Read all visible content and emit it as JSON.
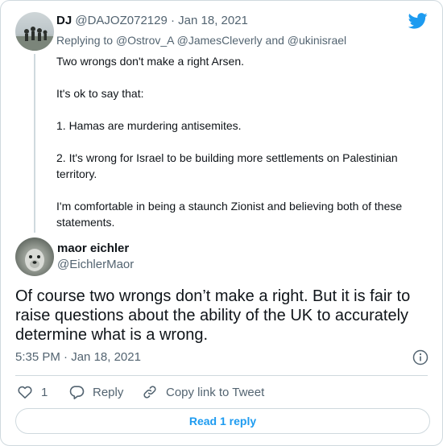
{
  "colors": {
    "accent": "#1d9bf0",
    "secondary_text": "#536471",
    "border": "#cfd9de"
  },
  "parent": {
    "name": "DJ",
    "handle": "@DAJOZ072129",
    "separator": "·",
    "date": "Jan 18, 2021",
    "replying_prefix": "Replying to",
    "mention_1": "@Ostrov_A",
    "mention_2": "@JamesCleverly",
    "and_word": "and",
    "mention_3": "@ukinisrael",
    "paragraphs": [
      "Two wrongs don't make a right Arsen.",
      "It's ok to say that:",
      "1. Hamas are murdering antisemites.",
      "2. It's wrong for Israel to be building more settlements on Palestinian territory.",
      "I'm comfortable in being a staunch Zionist and believing both of these statements."
    ]
  },
  "tweet": {
    "name": "maor eichler",
    "handle": "@EichlerMaor",
    "text": "Of course two wrongs don’t make a right. But it is fair to raise questions about the ability of the UK to accurately determine what is a wrong.",
    "time": "5:35 PM",
    "separator": "·",
    "date": "Jan 18, 2021"
  },
  "actions": {
    "like_count": "1",
    "reply_label": "Reply",
    "copy_link_label": "Copy link to Tweet"
  },
  "read_reply_label": "Read 1 reply",
  "icons": [
    "twitter-bird-icon",
    "info-icon",
    "heart-icon",
    "reply-icon",
    "link-icon"
  ]
}
